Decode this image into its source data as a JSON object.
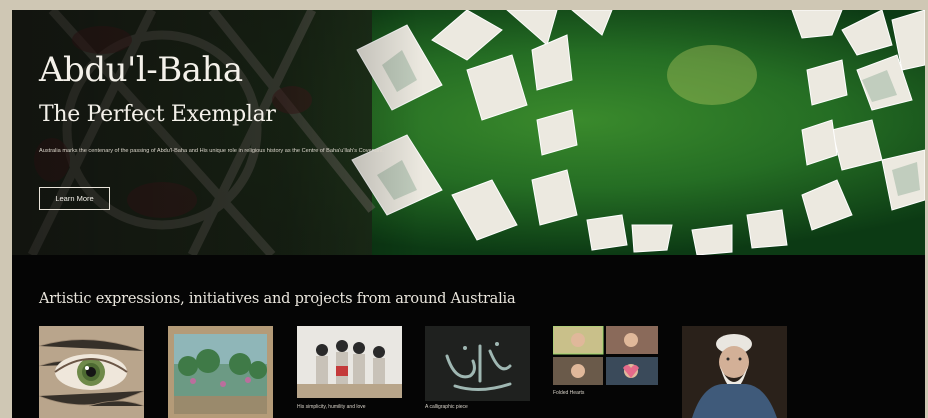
{
  "hero": {
    "title": "Abdu'l-Baha",
    "subtitle": "The Perfect Exemplar",
    "description": "Australia marks the centenary of the passing of Abdu'l-Baha and His unique role in religious history as the Centre of Baha'u'llah's Covenant.",
    "button_label": "Learn More"
  },
  "section": {
    "title": "Artistic expressions, initiatives and projects from around Australia",
    "cards": [
      {
        "image": "eye-painting",
        "caption": ""
      },
      {
        "image": "painted-garden-canvas",
        "caption": ""
      },
      {
        "image": "children-dancing-photo",
        "caption": "His simplicity, humility and love"
      },
      {
        "image": "calligraphy-artwork",
        "caption": "A calligraphic piece"
      },
      {
        "image": "video-call-grid",
        "caption": "Folded Hearts"
      },
      {
        "image": "portrait-painting",
        "caption": ""
      }
    ]
  },
  "colors": {
    "background": "#050505",
    "hero_green": "#1f5a22",
    "text": "#f4f1ea"
  }
}
